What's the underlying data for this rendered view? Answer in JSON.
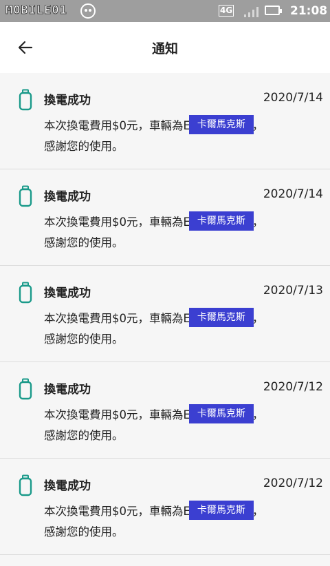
{
  "status_bar": {
    "logo_text": "MOBILE01",
    "network": "4G",
    "time": "21:08"
  },
  "header": {
    "title": "通知",
    "back_icon": "arrow-left-icon"
  },
  "notifications": [
    {
      "title": "換電成功",
      "date": "2020/7/14",
      "line1_prefix": "本次換電費用$0元，車輛為E",
      "plate": "卡爾馬克斯",
      "line1_suffix": "，",
      "line2": "感謝您的使用。"
    },
    {
      "title": "換電成功",
      "date": "2020/7/14",
      "line1_prefix": "本次換電費用$0元，車輛為E",
      "plate": "卡爾馬克斯",
      "line1_suffix": "，",
      "line2": "感謝您的使用。"
    },
    {
      "title": "換電成功",
      "date": "2020/7/13",
      "line1_prefix": "本次換電費用$0元，車輛為E",
      "plate": "卡爾馬克斯",
      "line1_suffix": "，",
      "line2": "感謝您的使用。"
    },
    {
      "title": "換電成功",
      "date": "2020/7/12",
      "line1_prefix": "本次換電費用$0元，車輛為E",
      "plate": "卡爾馬克斯",
      "line1_suffix": "，",
      "line2": "感謝您的使用。"
    },
    {
      "title": "換電成功",
      "date": "2020/7/12",
      "line1_prefix": "本次換電費用$0元，車輛為E",
      "plate": "卡爾馬克斯",
      "line1_suffix": "，",
      "line2": "感謝您的使用。"
    }
  ],
  "colors": {
    "battery_icon": "#1a9a8a",
    "plate_bg": "#3b3fd1"
  }
}
